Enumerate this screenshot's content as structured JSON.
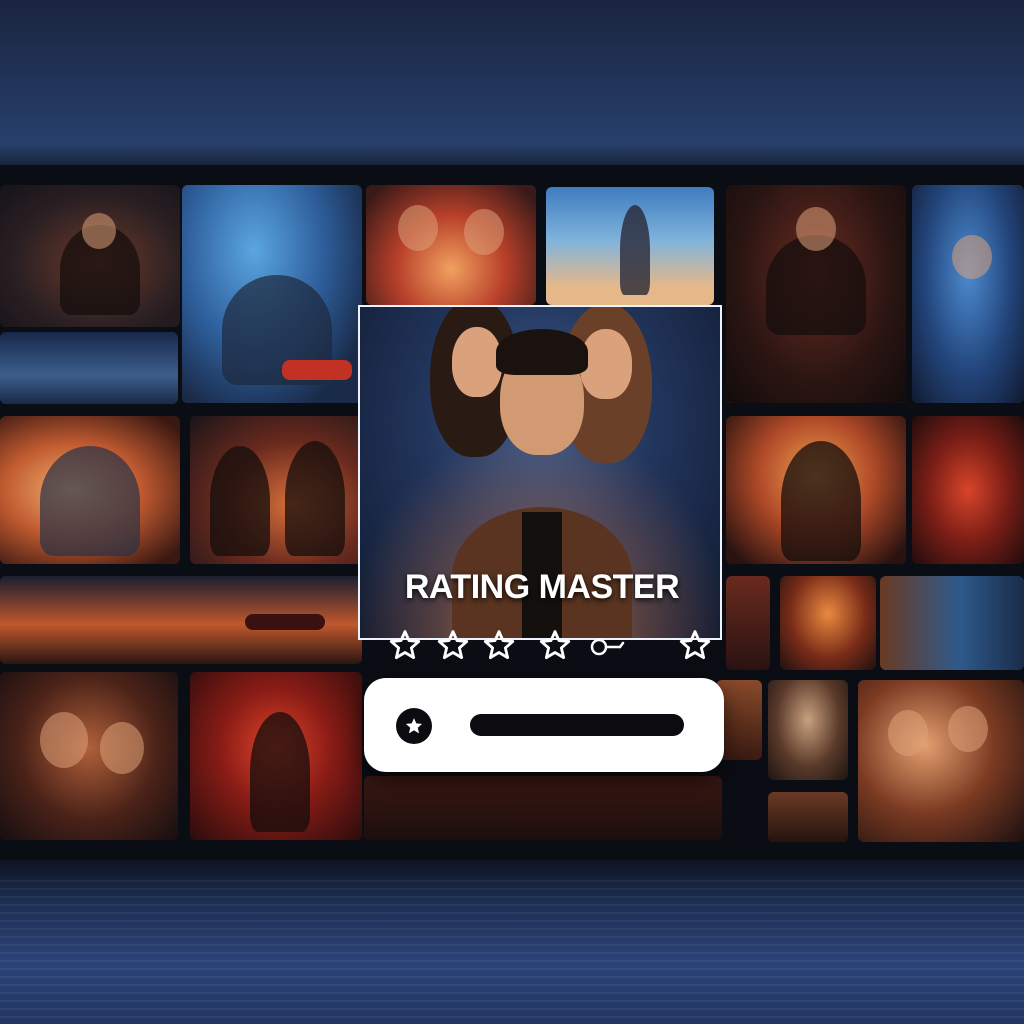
{
  "app": {
    "title": "RATING MASTER"
  },
  "rating": {
    "stars_shown": 5,
    "value_fraction": null
  },
  "icons": {
    "star": "star-outline-icon",
    "search": "magnifier-icon",
    "bar_badge": "star-badge-icon"
  },
  "colors": {
    "background": "#0b0d14",
    "frame": "#eef2fb",
    "title_text": "#ffffff",
    "bar": "#ffffff",
    "bar_track": "#0c0c10"
  }
}
